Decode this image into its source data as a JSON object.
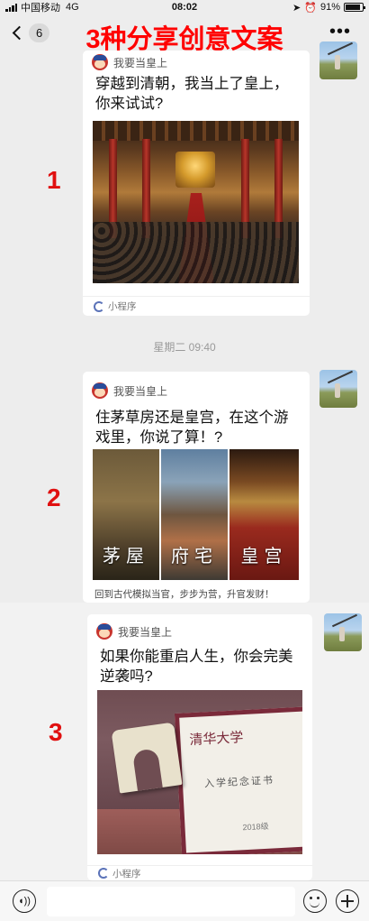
{
  "status_bar": {
    "carrier": "中国移动",
    "network": "4G",
    "time": "08:02",
    "battery": "91%",
    "battery_level": 0.91
  },
  "nav": {
    "back_count": "6",
    "title": "3种分享创意文案",
    "more": "•••"
  },
  "labels": [
    "1",
    "2",
    "3"
  ],
  "timestamp": "星期二 09:40",
  "messages": [
    {
      "app_name": "我要当皇上",
      "text": "穿越到清朝，我当上了皇上，你来试试?",
      "footer": "小程序"
    },
    {
      "app_name": "我要当皇上",
      "text": "住茅草房还是皇宫，在这个游戏里，你说了算！?",
      "panels": [
        "茅屋",
        "府宅",
        "皇宫"
      ],
      "caption": "回到古代模拟当官，步步为营，升官发财！"
    },
    {
      "app_name": "我要当皇上",
      "text": "如果你能重启人生，你会完美逆袭吗?",
      "cert": {
        "university": "清华大学",
        "title": "入学纪念证书",
        "year": "2018级"
      },
      "footer": "小程序"
    }
  ]
}
